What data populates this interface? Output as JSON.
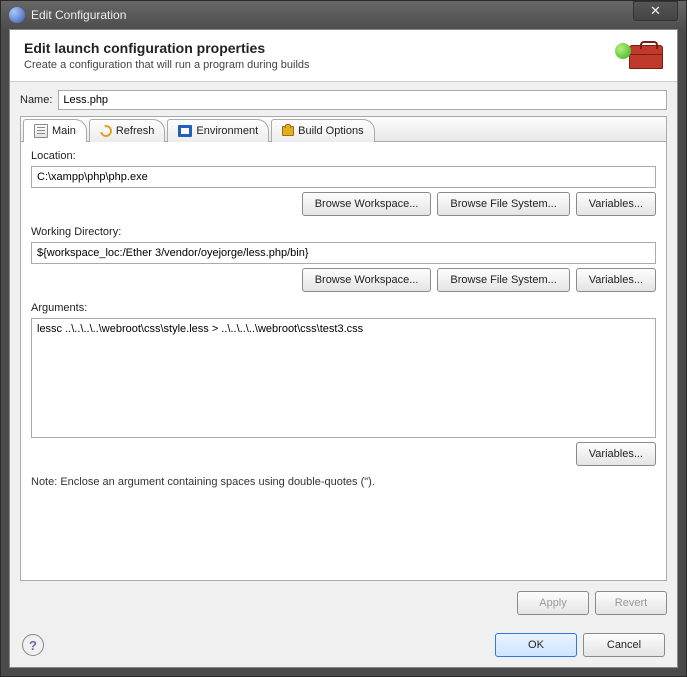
{
  "window": {
    "title": "Edit Configuration"
  },
  "header": {
    "title": "Edit launch configuration properties",
    "subtitle": "Create a configuration that will run a program during builds"
  },
  "name": {
    "label": "Name:",
    "value": "Less.php"
  },
  "tabs": {
    "main": "Main",
    "refresh": "Refresh",
    "environment": "Environment",
    "build": "Build Options"
  },
  "main_tab": {
    "location_label": "Location:",
    "location_value": "C:\\xampp\\php\\php.exe",
    "workdir_label": "Working Directory:",
    "workdir_value": "${workspace_loc:/Ether 3/vendor/oyejorge/less.php/bin}",
    "arguments_label": "Arguments:",
    "arguments_value": "lessc ..\\..\\..\\..\\webroot\\css\\style.less > ..\\..\\..\\..\\webroot\\css\\test3.css",
    "note": "Note: Enclose an argument containing spaces using double-quotes (\").",
    "browse_workspace": "Browse Workspace...",
    "browse_filesystem": "Browse File System...",
    "variables": "Variables..."
  },
  "buttons": {
    "apply": "Apply",
    "revert": "Revert",
    "ok": "OK",
    "cancel": "Cancel"
  }
}
